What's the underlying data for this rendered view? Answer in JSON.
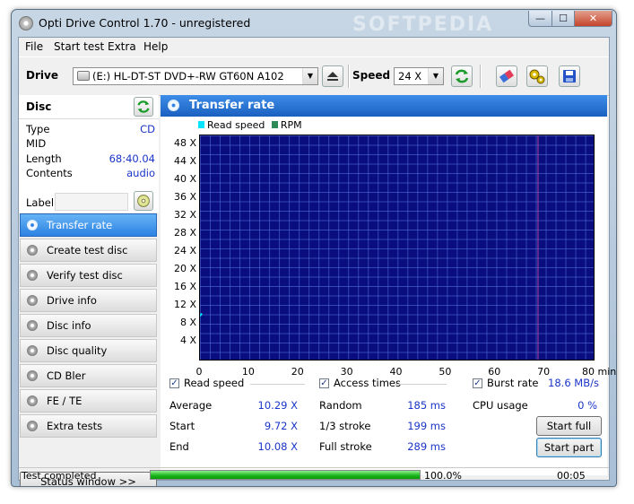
{
  "window": {
    "title": "Opti Drive Control 1.70 - unregistered",
    "watermark": "SOFTPEDIA"
  },
  "title_buttons": {
    "minimize": "—",
    "maximize": "☐",
    "close": "✕"
  },
  "menu": [
    "File",
    "Start test",
    "Extra",
    "Help"
  ],
  "toolbar": {
    "drive_label": "Drive",
    "drive_value": "(E:)  HL-DT-ST DVD+-RW GT60N A102",
    "speed_label": "Speed",
    "speed_value": "24 X"
  },
  "disc": {
    "header": "Disc",
    "rows": [
      {
        "key": "Type",
        "value": "CD"
      },
      {
        "key": "MID",
        "value": ""
      },
      {
        "key": "Length",
        "value": "68:40.04"
      },
      {
        "key": "Contents",
        "value": "audio"
      }
    ],
    "label_key": "Label"
  },
  "nav": [
    "Transfer rate",
    "Create test disc",
    "Verify test disc",
    "Drive info",
    "Disc info",
    "Disc quality",
    "CD Bler",
    "FE / TE",
    "Extra tests"
  ],
  "nav_active_index": 0,
  "status_window_button": "Status window >>",
  "panel": {
    "title": "Transfer rate",
    "legend": [
      {
        "label": "Read speed",
        "color": "#00e5ff"
      },
      {
        "label": "RPM",
        "color": "#2e8b57"
      }
    ]
  },
  "chart_data": {
    "type": "line",
    "title": "Transfer rate",
    "xlabel": "min",
    "ylabel": "",
    "xlim": [
      0,
      80
    ],
    "ylim": [
      0,
      50
    ],
    "x_ticks": [
      "0",
      "10",
      "20",
      "30",
      "40",
      "50",
      "60",
      "70",
      "80 min"
    ],
    "y_ticks": [
      "48 X",
      "44 X",
      "40 X",
      "36 X",
      "32 X",
      "28 X",
      "24 X",
      "20 X",
      "16 X",
      "12 X",
      "8 X",
      "4 X"
    ],
    "grid": true,
    "legend_position": "top-left",
    "cursor_x": 68.7,
    "series": [
      {
        "name": "Read speed",
        "color": "#00e5ff",
        "x": [
          0.0,
          0.2,
          0.4
        ],
        "y": [
          9.72,
          10.0,
          10.29
        ]
      },
      {
        "name": "RPM",
        "color": "#2e8b57",
        "x": [],
        "y": []
      }
    ]
  },
  "groups": {
    "read_speed": {
      "title": "Read speed",
      "checked": true,
      "rows": [
        [
          "Average",
          "10.29 X"
        ],
        [
          "Start",
          "9.72 X"
        ],
        [
          "End",
          "10.08 X"
        ]
      ]
    },
    "access_times": {
      "title": "Access times",
      "checked": true,
      "rows": [
        [
          "Random",
          "185 ms"
        ],
        [
          "1/3 stroke",
          "199 ms"
        ],
        [
          "Full stroke",
          "289 ms"
        ]
      ]
    },
    "burst_rate": {
      "title": "Burst rate",
      "checked": true,
      "value": "18.6 MB/s",
      "cpu_label": "CPU usage",
      "cpu_value": "0 %"
    }
  },
  "buttons": {
    "start_full": "Start full",
    "start_part": "Start part"
  },
  "status": {
    "text": "Test completed",
    "progress": 100,
    "progress_text": "100.0%",
    "time": "00:05"
  }
}
